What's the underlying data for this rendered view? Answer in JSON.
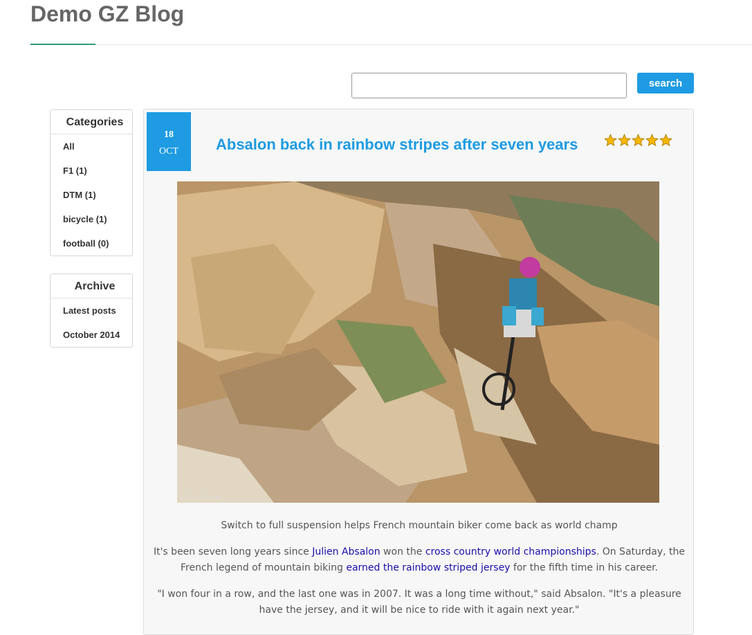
{
  "site": {
    "title": "Demo GZ Blog"
  },
  "search": {
    "placeholder": "",
    "value": "",
    "button_label": "search"
  },
  "sidebar": {
    "categories": {
      "title": "Categories",
      "items": [
        {
          "label": "All"
        },
        {
          "label": "F1 (1)"
        },
        {
          "label": "DTM (1)"
        },
        {
          "label": "bicycle (1)"
        },
        {
          "label": "football (0)"
        }
      ]
    },
    "archive": {
      "title": "Archive",
      "items": [
        {
          "label": "Latest posts"
        },
        {
          "label": "October 2014"
        }
      ]
    }
  },
  "post": {
    "date": {
      "day": "18",
      "month": "OCT"
    },
    "title": "Absalon back in rainbow stripes after seven years",
    "rating": {
      "stars": 5,
      "max": 5,
      "star_icon": "star-icon",
      "color": "#f5b800"
    },
    "image_credit": "© Colin Meagher",
    "subtitle": "Switch to full suspension helps French mountain biker come back as world champ",
    "p2": {
      "t1": "It's been seven long years since ",
      "l1": "Julien Absalon",
      "t2": " won the ",
      "l2": "cross country world championships",
      "t3": ". On Saturday, the French legend of mountain biking ",
      "l3": "earned the rainbow striped jersey",
      "t4": " for the fifth time in his career."
    },
    "p3": "\"I won four in a row, and the last one was in 2007. It was a long time without,\" said Absalon. \"It's a pleasure have the jersey, and it will be nice to ride with it again next year.\""
  },
  "colors": {
    "accent": "#1e9be2",
    "header_accent": "#2e9a7a",
    "link": "#1a0dab"
  }
}
